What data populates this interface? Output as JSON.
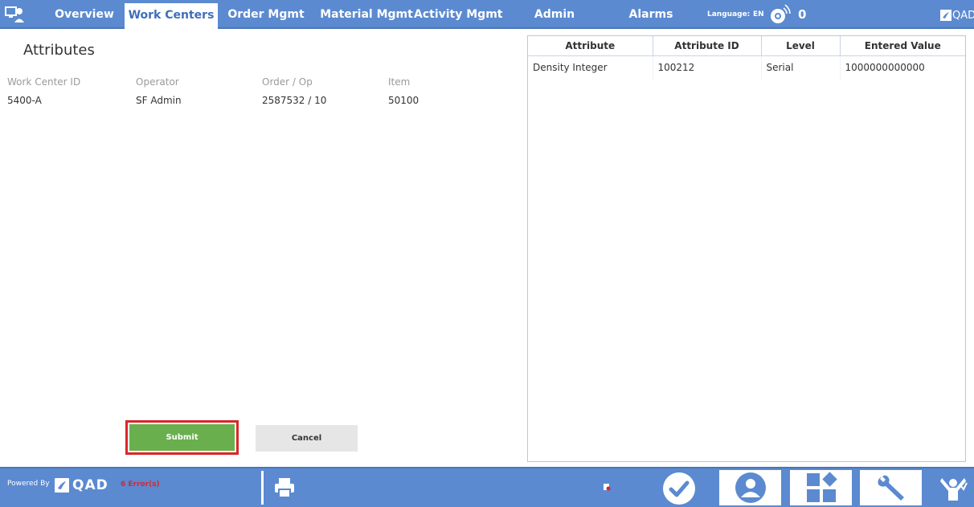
{
  "nav": {
    "home_icon": "workstation-home-icon",
    "tabs": [
      {
        "label": "Overview",
        "active": false
      },
      {
        "label": "Work Centers",
        "active": true
      },
      {
        "label": "Order Mgmt",
        "active": false
      },
      {
        "label": "Material Mgmt",
        "active": false
      },
      {
        "label": "Activity Mgmt",
        "active": false
      },
      {
        "label": "Admin",
        "active": false
      },
      {
        "label": "Alarms",
        "active": false
      }
    ],
    "language_label": "Language:",
    "language_value": "EN",
    "notification_icon": "broadcast-icon",
    "notification_count": "0",
    "brand": "QAD"
  },
  "attributes": {
    "title": "Attributes",
    "headers": [
      "Work Center ID",
      "Operator",
      "Order / Op",
      "Item"
    ],
    "values": [
      "5400-A",
      "SF Admin",
      "2587532 / 10",
      "50100"
    ]
  },
  "table": {
    "columns": [
      "Attribute",
      "Attribute ID",
      "Level",
      "Entered Value"
    ],
    "rows": [
      [
        "Density Integer",
        "100212",
        "Serial",
        "1000000000000"
      ]
    ]
  },
  "actions": {
    "submit_label": "Submit",
    "cancel_label": "Cancel"
  },
  "footer": {
    "powered_by": "Powered By",
    "brand": "QAD",
    "errors": "6 Error(s)",
    "icons": [
      "printer-icon",
      "small-status-icon",
      "check-icon",
      "user-icon",
      "grid-icon",
      "wrench-icon",
      "cheer-icon"
    ]
  },
  "colors": {
    "nav_bg": "#5b8ad0",
    "active_tab_text": "#3f6fba",
    "submit_bg": "#6aaf4d",
    "submit_outline": "#d9262b",
    "error_text": "#d9262b"
  }
}
